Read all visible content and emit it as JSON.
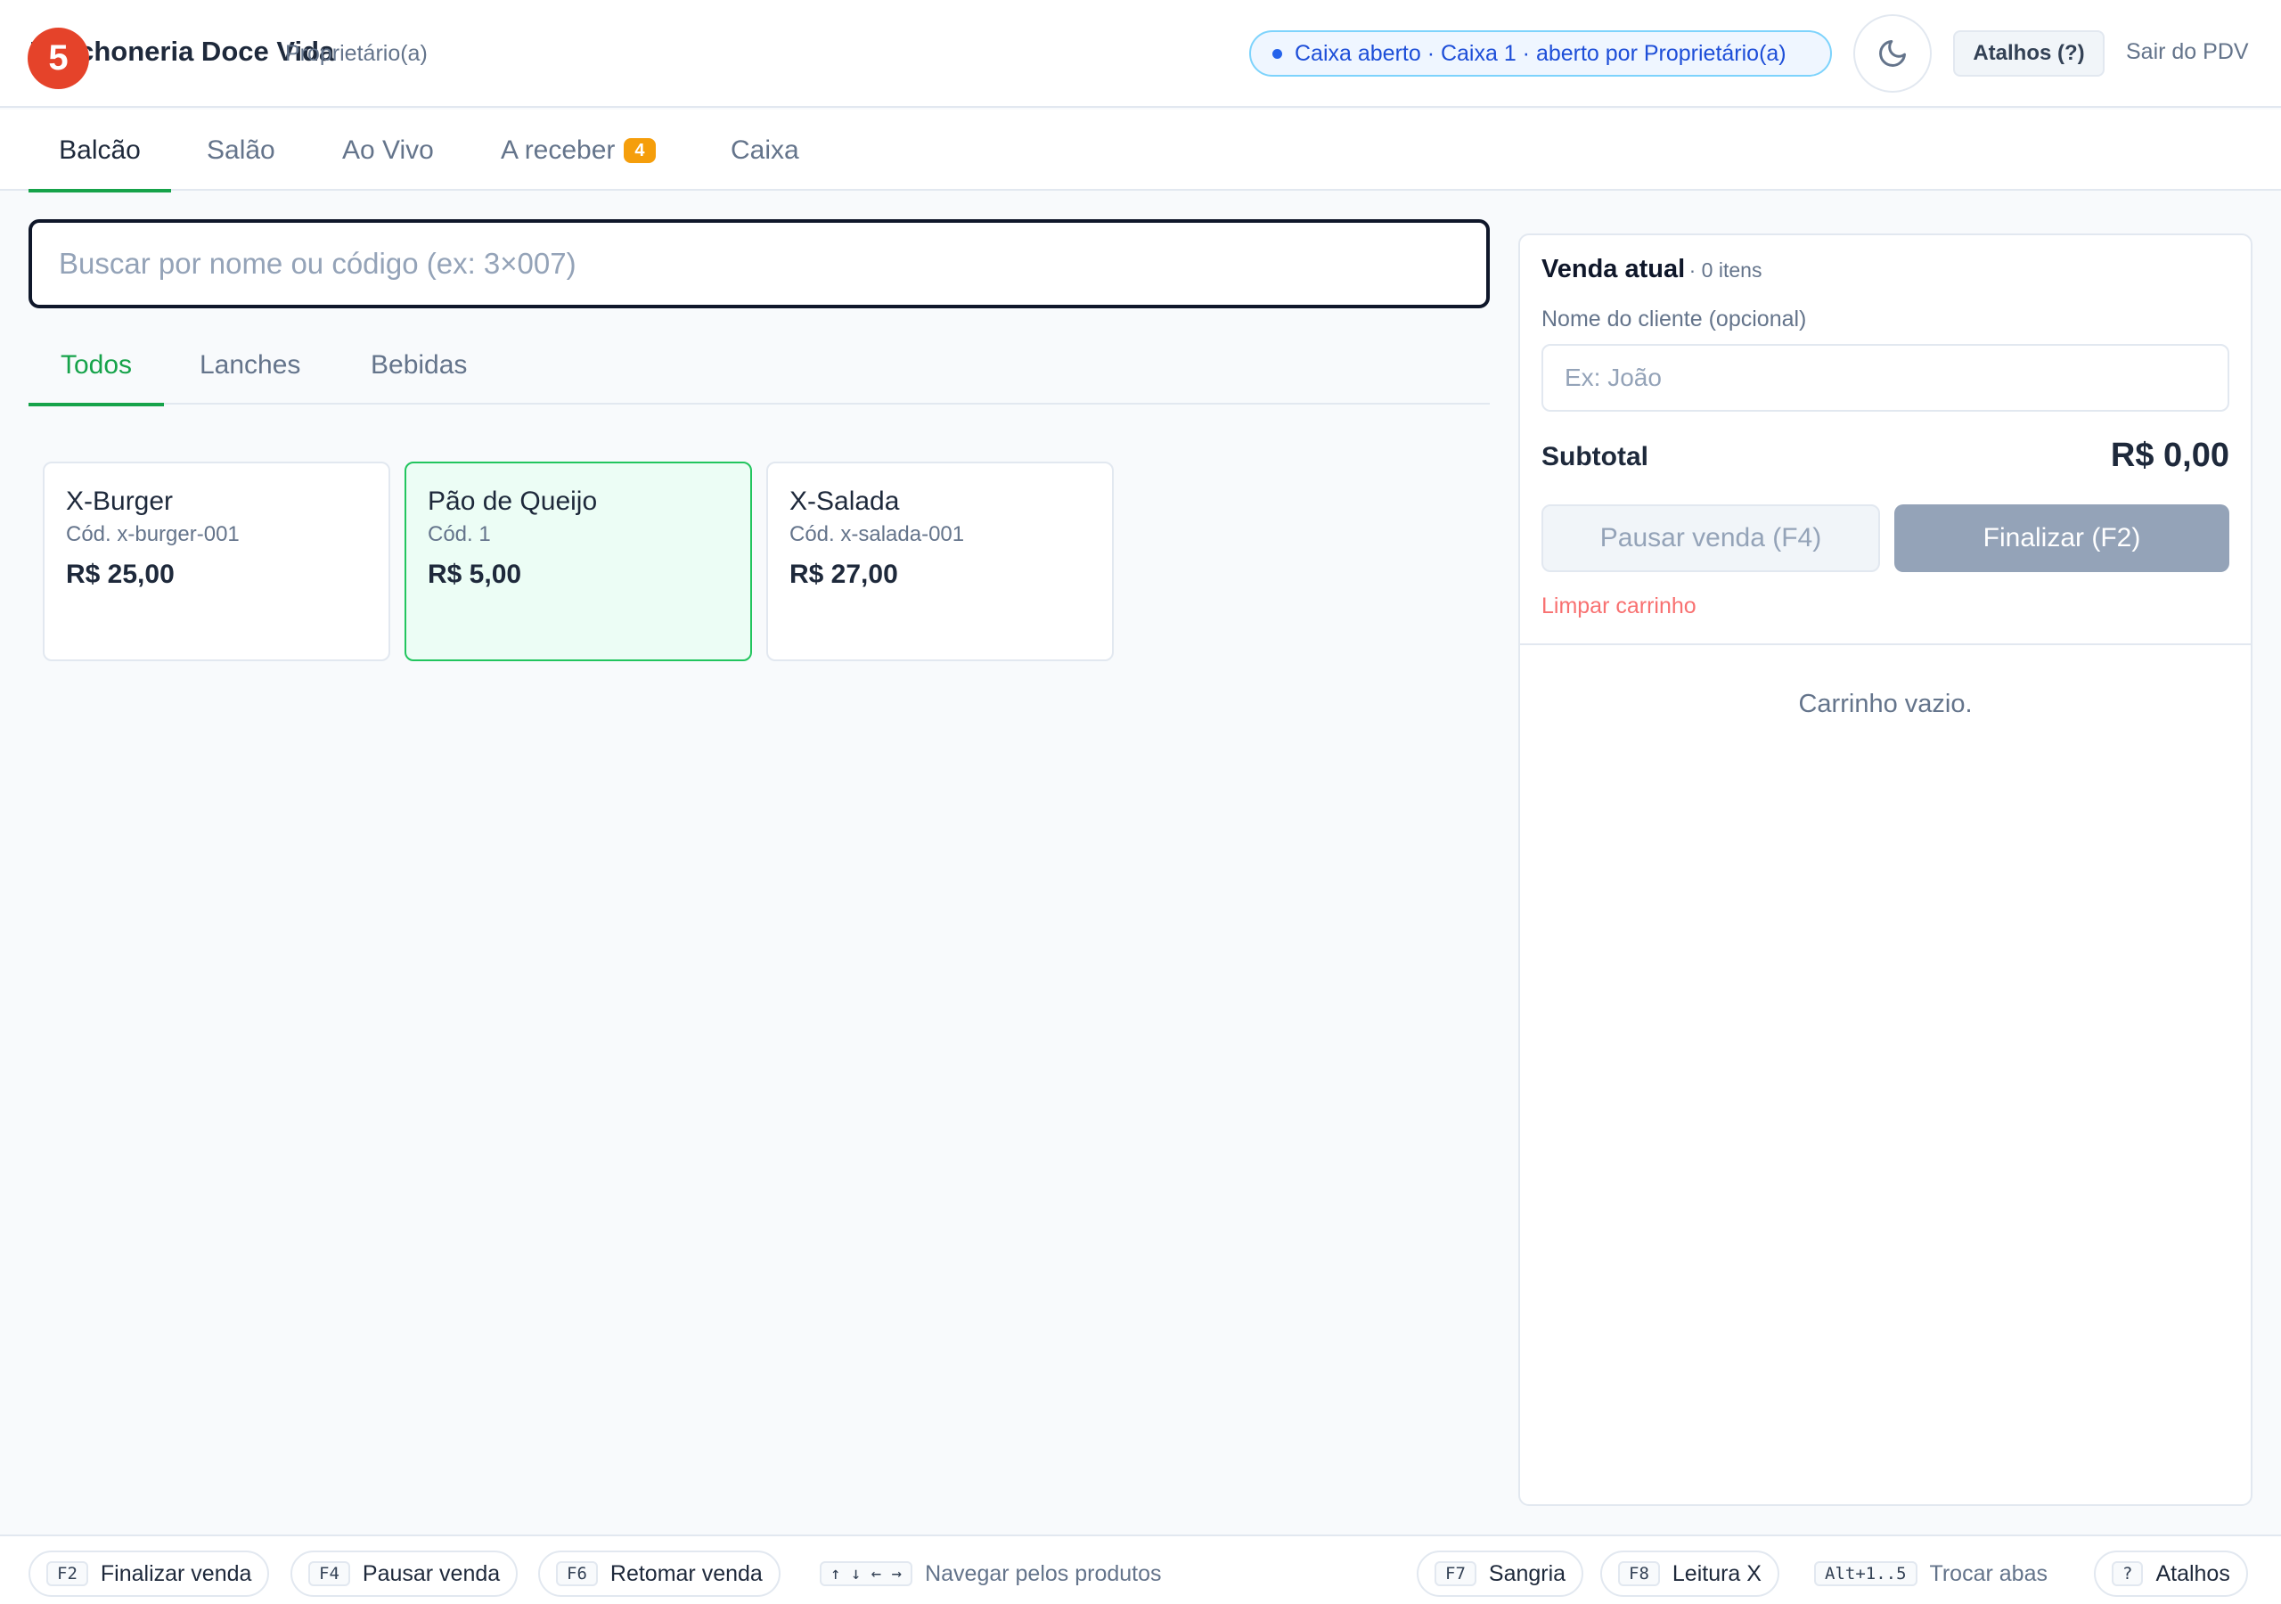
{
  "header": {
    "step_badge": "5",
    "brand": "Lanchoneria Doce Vida",
    "role": "Proprietário(a)",
    "status": "Caixa aberto · Caixa 1 · aberto por Proprietário(a)",
    "theme_icon": "moon-icon",
    "shortcuts_label": "Atalhos (?)",
    "logout_label": "Sair do PDV"
  },
  "main_tabs": [
    {
      "label": "Balcão",
      "active": true
    },
    {
      "label": "Salão"
    },
    {
      "label": "Ao Vivo"
    },
    {
      "label": "A receber",
      "badge": "4"
    },
    {
      "label": "Caixa"
    }
  ],
  "search": {
    "placeholder": "Buscar por nome ou código (ex: 3×007)",
    "value": ""
  },
  "category_tabs": [
    {
      "label": "Todos",
      "active": true
    },
    {
      "label": "Lanches"
    },
    {
      "label": "Bebidas"
    }
  ],
  "products": [
    {
      "name": "X-Burger",
      "code": "Cód. x-burger-001",
      "price": "R$ 25,00",
      "selected": false
    },
    {
      "name": "Pão de Queijo",
      "code": "Cód. 1",
      "price": "R$ 5,00",
      "selected": true
    },
    {
      "name": "X-Salada",
      "code": "Cód. x-salada-001",
      "price": "R$ 27,00",
      "selected": false
    }
  ],
  "cart": {
    "title": "Venda atual",
    "count": "· 0 itens",
    "client_label": "Nome do cliente (opcional)",
    "client_placeholder": "Ex: João",
    "subtotal_label": "Subtotal",
    "subtotal_value": "R$ 0,00",
    "pause_label": "Pausar venda (F4)",
    "finish_label": "Finalizar (F2)",
    "clear_label": "Limpar carrinho",
    "empty_text": "Carrinho vazio."
  },
  "footer": {
    "shortcuts": [
      {
        "key": "F2",
        "label": "Finalizar venda"
      },
      {
        "key": "F4",
        "label": "Pausar venda"
      },
      {
        "key": "F6",
        "label": "Retomar venda"
      },
      {
        "key": "↑ ↓ ← →",
        "label": "Navegar pelos produtos"
      },
      {
        "key": "F7",
        "label": "Sangria"
      },
      {
        "key": "F8",
        "label": "Leitura X"
      },
      {
        "key": "Alt+1..5",
        "label": "Trocar abas"
      },
      {
        "key": "?",
        "label": "Atalhos"
      }
    ]
  }
}
